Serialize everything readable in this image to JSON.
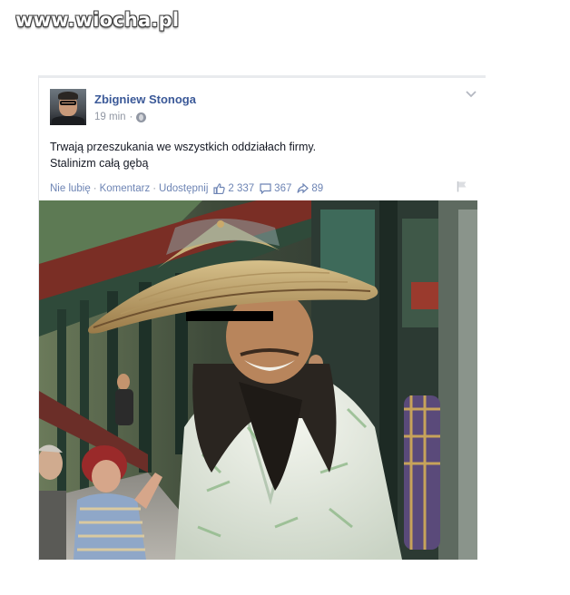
{
  "watermark": "www.wiocha.pl",
  "post": {
    "author": "Zbigniew Stonoga",
    "time": "19 min",
    "time_separator": "·",
    "privacy_icon": "globe-icon",
    "text_lines": [
      "Trwają przeszukania we wszystkich oddziałach firmy.",
      "Stalinizm całą gębą"
    ],
    "actions": {
      "unlike": "Nie lubię",
      "comment": "Komentarz",
      "share": "Udostępnij",
      "separator": "·"
    },
    "stats": {
      "likes": "2 337",
      "comments": "367",
      "shares": "89"
    },
    "icons": {
      "options": "chevron-down-icon",
      "report": "flag-icon",
      "like": "thumbs-up-icon",
      "comment": "comment-icon",
      "share": "share-arrow-icon"
    }
  },
  "colors": {
    "link": "#3b5998",
    "action": "#6d84b4",
    "meta": "#9197a3"
  }
}
